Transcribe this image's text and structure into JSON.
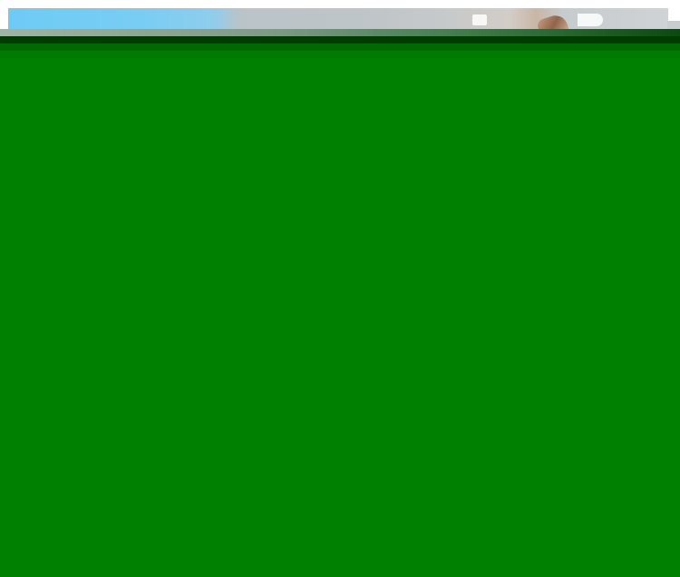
{
  "colors": {
    "overlay_green": "#008000",
    "overlay_dark_green": "#003c00",
    "background_sky_blue": "#6ecbf5",
    "background_grey": "#bfc5c8"
  },
  "icons": {
    "background": "partial-photo-strip"
  }
}
